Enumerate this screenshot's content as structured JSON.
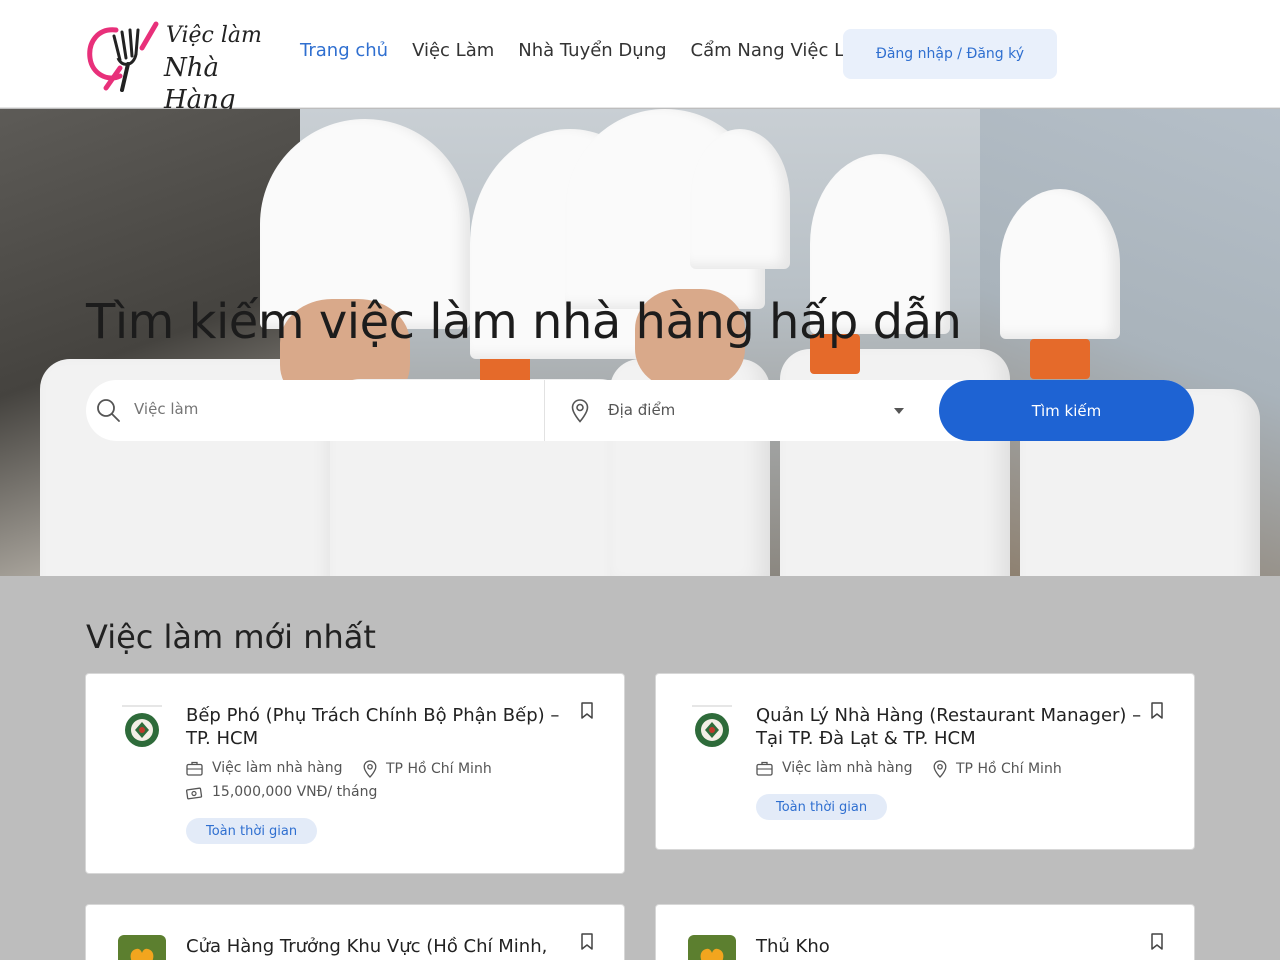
{
  "brand": {
    "line1": "Việc làm",
    "line2": "Nhà Hàng",
    "logo_color": "#e8307a"
  },
  "nav": [
    {
      "label": "Trang chủ",
      "active": true
    },
    {
      "label": "Việc Làm"
    },
    {
      "label": "Nhà Tuyển Dụng"
    },
    {
      "label": "Cẩm Nang Việc Làm"
    }
  ],
  "login_label": "Đăng nhập / Đăng ký",
  "hero": {
    "title": "Tìm kiếm việc làm nhà hàng hấp dẫn",
    "keyword_placeholder": "Việc làm",
    "location_placeholder": "Địa điểm",
    "search_label": "Tìm kiếm"
  },
  "jobs_section": {
    "title": "Việc làm mới nhất",
    "jobs": [
      {
        "title": "Bếp Phó (Phụ Trách Chính Bộ Phận Bếp) – TP. HCM",
        "category": "Việc làm nhà hàng",
        "location": "TP Hồ Chí Minh",
        "salary": "15,000,000 VNĐ/ tháng",
        "type": "Toàn thời gian",
        "icon": "round-seal-logo"
      },
      {
        "title": "Quản Lý Nhà Hàng (Restaurant Manager) – Tại TP. Đà Lạt & TP. HCM",
        "category": "Việc làm nhà hàng",
        "location": "TP Hồ Chí Minh",
        "type": "Toàn thời gian",
        "icon": "round-seal-logo"
      },
      {
        "title": "Cửa Hàng Trưởng Khu Vực (Hồ Chí Minh, Bình",
        "icon": "green-heart-logo"
      },
      {
        "title": "Thủ Kho",
        "icon": "green-heart-logo"
      }
    ]
  },
  "colors": {
    "primary": "#1e63d3",
    "link": "#2f6fd0",
    "tag_bg": "#e3ebf8",
    "section_bg": "#bdbdbd"
  }
}
